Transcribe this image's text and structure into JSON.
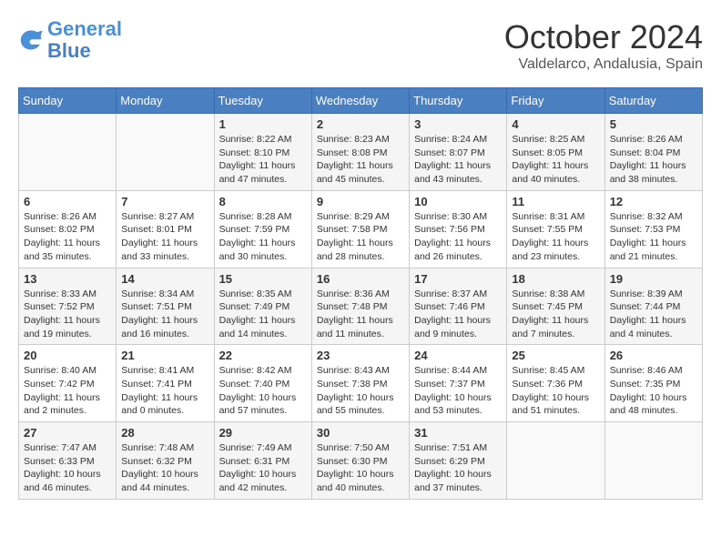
{
  "header": {
    "logo_general": "General",
    "logo_blue": "Blue",
    "month": "October 2024",
    "location": "Valdelarco, Andalusia, Spain"
  },
  "days_of_week": [
    "Sunday",
    "Monday",
    "Tuesday",
    "Wednesday",
    "Thursday",
    "Friday",
    "Saturday"
  ],
  "weeks": [
    [
      {
        "day": "",
        "content": ""
      },
      {
        "day": "",
        "content": ""
      },
      {
        "day": "1",
        "content": "Sunrise: 8:22 AM\nSunset: 8:10 PM\nDaylight: 11 hours and 47 minutes."
      },
      {
        "day": "2",
        "content": "Sunrise: 8:23 AM\nSunset: 8:08 PM\nDaylight: 11 hours and 45 minutes."
      },
      {
        "day": "3",
        "content": "Sunrise: 8:24 AM\nSunset: 8:07 PM\nDaylight: 11 hours and 43 minutes."
      },
      {
        "day": "4",
        "content": "Sunrise: 8:25 AM\nSunset: 8:05 PM\nDaylight: 11 hours and 40 minutes."
      },
      {
        "day": "5",
        "content": "Sunrise: 8:26 AM\nSunset: 8:04 PM\nDaylight: 11 hours and 38 minutes."
      }
    ],
    [
      {
        "day": "6",
        "content": "Sunrise: 8:26 AM\nSunset: 8:02 PM\nDaylight: 11 hours and 35 minutes."
      },
      {
        "day": "7",
        "content": "Sunrise: 8:27 AM\nSunset: 8:01 PM\nDaylight: 11 hours and 33 minutes."
      },
      {
        "day": "8",
        "content": "Sunrise: 8:28 AM\nSunset: 7:59 PM\nDaylight: 11 hours and 30 minutes."
      },
      {
        "day": "9",
        "content": "Sunrise: 8:29 AM\nSunset: 7:58 PM\nDaylight: 11 hours and 28 minutes."
      },
      {
        "day": "10",
        "content": "Sunrise: 8:30 AM\nSunset: 7:56 PM\nDaylight: 11 hours and 26 minutes."
      },
      {
        "day": "11",
        "content": "Sunrise: 8:31 AM\nSunset: 7:55 PM\nDaylight: 11 hours and 23 minutes."
      },
      {
        "day": "12",
        "content": "Sunrise: 8:32 AM\nSunset: 7:53 PM\nDaylight: 11 hours and 21 minutes."
      }
    ],
    [
      {
        "day": "13",
        "content": "Sunrise: 8:33 AM\nSunset: 7:52 PM\nDaylight: 11 hours and 19 minutes."
      },
      {
        "day": "14",
        "content": "Sunrise: 8:34 AM\nSunset: 7:51 PM\nDaylight: 11 hours and 16 minutes."
      },
      {
        "day": "15",
        "content": "Sunrise: 8:35 AM\nSunset: 7:49 PM\nDaylight: 11 hours and 14 minutes."
      },
      {
        "day": "16",
        "content": "Sunrise: 8:36 AM\nSunset: 7:48 PM\nDaylight: 11 hours and 11 minutes."
      },
      {
        "day": "17",
        "content": "Sunrise: 8:37 AM\nSunset: 7:46 PM\nDaylight: 11 hours and 9 minutes."
      },
      {
        "day": "18",
        "content": "Sunrise: 8:38 AM\nSunset: 7:45 PM\nDaylight: 11 hours and 7 minutes."
      },
      {
        "day": "19",
        "content": "Sunrise: 8:39 AM\nSunset: 7:44 PM\nDaylight: 11 hours and 4 minutes."
      }
    ],
    [
      {
        "day": "20",
        "content": "Sunrise: 8:40 AM\nSunset: 7:42 PM\nDaylight: 11 hours and 2 minutes."
      },
      {
        "day": "21",
        "content": "Sunrise: 8:41 AM\nSunset: 7:41 PM\nDaylight: 11 hours and 0 minutes."
      },
      {
        "day": "22",
        "content": "Sunrise: 8:42 AM\nSunset: 7:40 PM\nDaylight: 10 hours and 57 minutes."
      },
      {
        "day": "23",
        "content": "Sunrise: 8:43 AM\nSunset: 7:38 PM\nDaylight: 10 hours and 55 minutes."
      },
      {
        "day": "24",
        "content": "Sunrise: 8:44 AM\nSunset: 7:37 PM\nDaylight: 10 hours and 53 minutes."
      },
      {
        "day": "25",
        "content": "Sunrise: 8:45 AM\nSunset: 7:36 PM\nDaylight: 10 hours and 51 minutes."
      },
      {
        "day": "26",
        "content": "Sunrise: 8:46 AM\nSunset: 7:35 PM\nDaylight: 10 hours and 48 minutes."
      }
    ],
    [
      {
        "day": "27",
        "content": "Sunrise: 7:47 AM\nSunset: 6:33 PM\nDaylight: 10 hours and 46 minutes."
      },
      {
        "day": "28",
        "content": "Sunrise: 7:48 AM\nSunset: 6:32 PM\nDaylight: 10 hours and 44 minutes."
      },
      {
        "day": "29",
        "content": "Sunrise: 7:49 AM\nSunset: 6:31 PM\nDaylight: 10 hours and 42 minutes."
      },
      {
        "day": "30",
        "content": "Sunrise: 7:50 AM\nSunset: 6:30 PM\nDaylight: 10 hours and 40 minutes."
      },
      {
        "day": "31",
        "content": "Sunrise: 7:51 AM\nSunset: 6:29 PM\nDaylight: 10 hours and 37 minutes."
      },
      {
        "day": "",
        "content": ""
      },
      {
        "day": "",
        "content": ""
      }
    ]
  ]
}
